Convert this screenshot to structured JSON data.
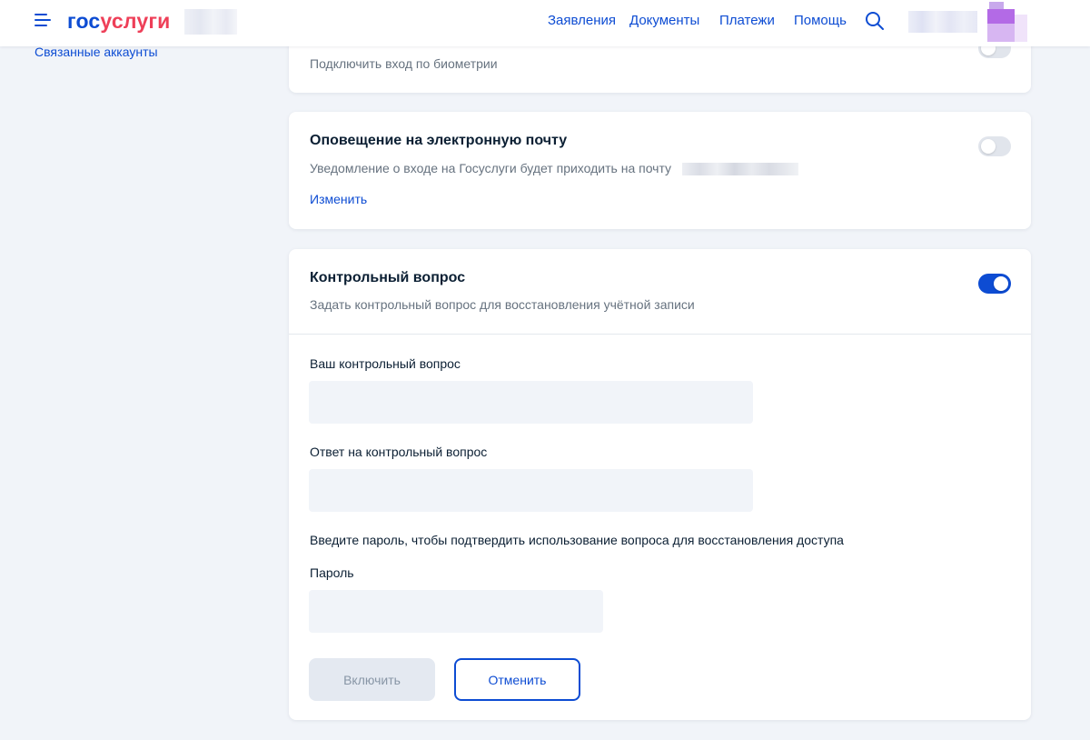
{
  "header": {
    "logo_part1": "гос",
    "logo_part2": "услуги",
    "nav": [
      "Заявления",
      "Документы",
      "Платежи",
      "Помощь"
    ]
  },
  "sidebar": {
    "linked_accounts": "Связанные аккаунты"
  },
  "biometrics_card": {
    "description": "Подключить вход по биометрии"
  },
  "email_card": {
    "title": "Оповещение на электронную почту",
    "description": "Уведомление о входе на Госуслуги будет приходить на почту",
    "change_link": "Изменить",
    "toggle_on": false
  },
  "security_question_card": {
    "title": "Контрольный вопрос",
    "description": "Задать контрольный вопрос для восстановления учётной записи",
    "toggle_on": true,
    "question_label": "Ваш контрольный вопрос",
    "question_value": "",
    "answer_label": "Ответ на контрольный вопрос",
    "answer_value": "",
    "password_note": "Введите пароль, чтобы подтвердить использование вопроса для восстановления доступа",
    "password_label": "Пароль",
    "password_value": "",
    "enable_button": "Включить",
    "cancel_button": "Отменить"
  },
  "colors": {
    "accent": "#0d4cd3",
    "brand_red": "#ee3f58",
    "background": "#f1f4f9"
  },
  "icons": {
    "menu": "menu-icon",
    "search": "search-icon",
    "avatar": "avatar"
  }
}
